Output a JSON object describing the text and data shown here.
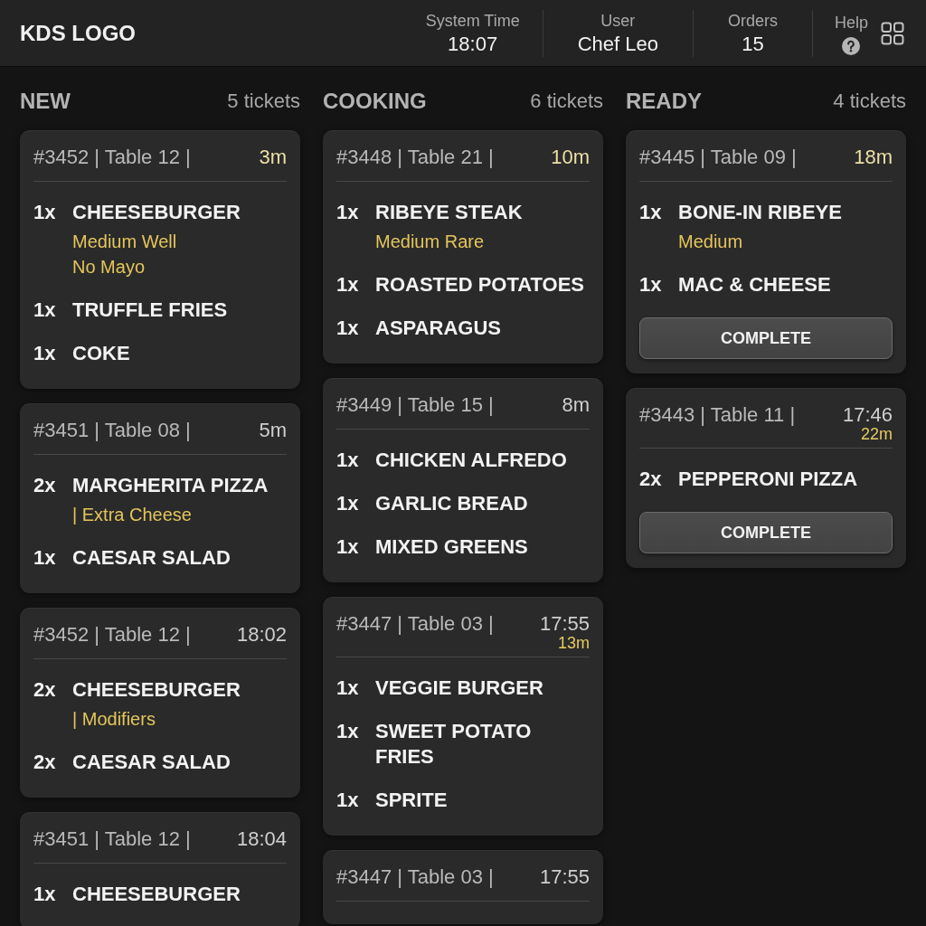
{
  "header": {
    "logo": "KDS LOGO",
    "stats": [
      {
        "label": "System Time",
        "value": "18:07"
      },
      {
        "label": "User",
        "value": "Chef Leo"
      },
      {
        "label": "Orders",
        "value": "15"
      }
    ],
    "help": "Help"
  },
  "columns": [
    {
      "title": "NEW",
      "count": "5 tickets",
      "tickets": [
        {
          "info": "#3452 | Table 12 |",
          "time": "3m",
          "time_alert": true,
          "items": [
            {
              "qty": "1x",
              "name": "CHEESEBURGER",
              "modifiers": [
                "Medium Well",
                "No Mayo"
              ]
            },
            {
              "qty": "1x",
              "name": "TRUFFLE FRIES"
            },
            {
              "qty": "1x",
              "name": "COKE"
            }
          ]
        },
        {
          "info": "#3451 | Table 08 |",
          "time": "5m",
          "time_alert": false,
          "items": [
            {
              "qty": "2x",
              "name": "MARGHERITA PIZZA",
              "modifiers": [
                "| Extra Cheese"
              ]
            },
            {
              "qty": "1x",
              "name": "CAESAR SALAD"
            }
          ]
        },
        {
          "info": "#3452 | Table 12 |",
          "time": "18:02",
          "time_alert": false,
          "items": [
            {
              "qty": "2x",
              "name": "CHEESEBURGER",
              "modifiers": [
                "| Modifiers"
              ]
            },
            {
              "qty": "2x",
              "name": "CAESAR SALAD"
            }
          ]
        },
        {
          "info": "#3451 | Table 12 |",
          "time": "18:04",
          "time_alert": false,
          "items": [
            {
              "qty": "1x",
              "name": "CHEESEBURGER"
            }
          ]
        }
      ]
    },
    {
      "title": "COOKING",
      "count": "6 tickets",
      "tickets": [
        {
          "info": "#3448 | Table 21 |",
          "time": "10m",
          "time_alert": true,
          "items": [
            {
              "qty": "1x",
              "name": "RIBEYE STEAK",
              "modifiers": [
                "Medium Rare"
              ]
            },
            {
              "qty": "1x",
              "name": "ROASTED POTATOES"
            },
            {
              "qty": "1x",
              "name": "ASPARAGUS"
            }
          ]
        },
        {
          "info": "#3449 | Table 15 |",
          "time": "8m",
          "time_alert": false,
          "items": [
            {
              "qty": "1x",
              "name": "CHICKEN ALFREDO"
            },
            {
              "qty": "1x",
              "name": "GARLIC BREAD"
            },
            {
              "qty": "1x",
              "name": "MIXED GREENS"
            }
          ]
        },
        {
          "info": "#3447 | Table 03 |",
          "time": "17:55",
          "time_alert": false,
          "elapsed": "13m",
          "items": [
            {
              "qty": "1x",
              "name": "VEGGIE BURGER"
            },
            {
              "qty": "1x",
              "name": "SWEET POTATO FRIES"
            },
            {
              "qty": "1x",
              "name": "SPRITE"
            }
          ]
        },
        {
          "info": "#3447 | Table 03 |",
          "time": "17:55",
          "time_alert": false
        }
      ]
    },
    {
      "title": "READY",
      "count": "4 tickets",
      "tickets": [
        {
          "info": "#3445 | Table 09 |",
          "time": "18m",
          "time_alert": true,
          "items": [
            {
              "qty": "1x",
              "name": "BONE-IN RIBEYE",
              "modifiers": [
                "Medium"
              ]
            },
            {
              "qty": "1x",
              "name": "MAC & CHEESE"
            }
          ],
          "action": "COMPLETE"
        },
        {
          "info": "#3443 | Table 11 |",
          "time": "17:46",
          "time_alert": false,
          "elapsed": "22m",
          "items": [
            {
              "qty": "2x",
              "name": "PEPPERONI PIZZA"
            }
          ],
          "action": "COMPLETE"
        }
      ]
    }
  ]
}
